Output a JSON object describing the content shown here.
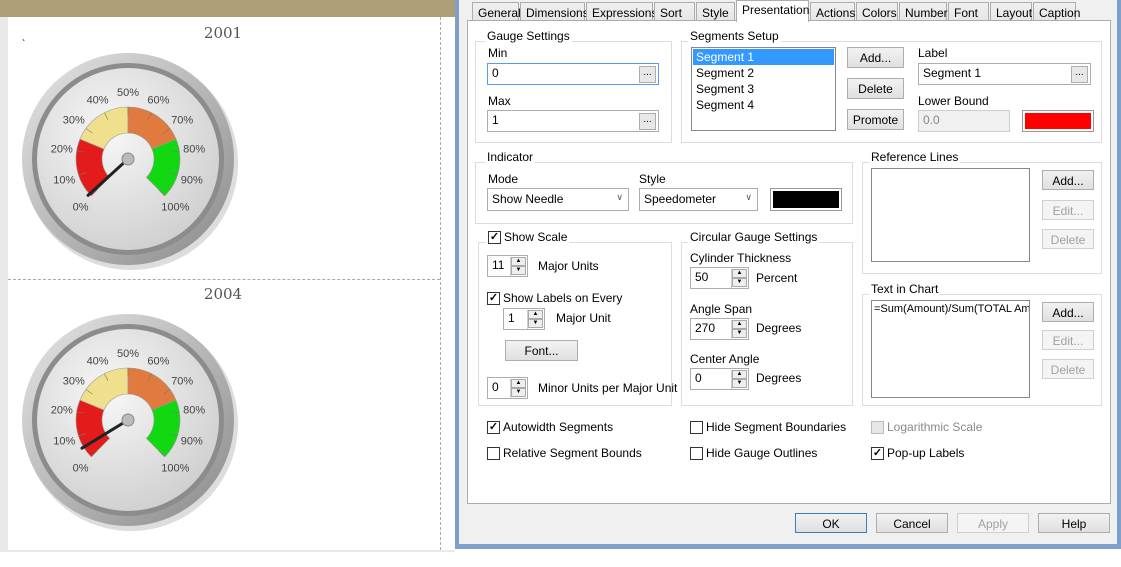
{
  "left_panel": {
    "mark": "ˎ",
    "charts": [
      {
        "title": "2001"
      },
      {
        "title": "2004"
      }
    ]
  },
  "chart_data": [
    {
      "type": "gauge",
      "title": "2001",
      "min": 0,
      "max": 1,
      "angle_span": 270,
      "tick_labels": [
        "0%",
        "10%",
        "20%",
        "30%",
        "40%",
        "50%",
        "60%",
        "70%",
        "80%",
        "90%",
        "100%"
      ],
      "segments": [
        {
          "from": 0,
          "to": 0.25,
          "color": "#e31b1b"
        },
        {
          "from": 0.25,
          "to": 0.5,
          "color": "#f0df8c"
        },
        {
          "from": 0.5,
          "to": 0.75,
          "color": "#e07a3f"
        },
        {
          "from": 0.75,
          "to": 1,
          "color": "#12d812"
        }
      ],
      "value": 0.01
    },
    {
      "type": "gauge",
      "title": "2004",
      "min": 0,
      "max": 1,
      "angle_span": 270,
      "tick_labels": [
        "0%",
        "10%",
        "20%",
        "30%",
        "40%",
        "50%",
        "60%",
        "70%",
        "80%",
        "90%",
        "100%"
      ],
      "segments": [
        {
          "from": 0,
          "to": 0.25,
          "color": "#e31b1b"
        },
        {
          "from": 0.25,
          "to": 0.5,
          "color": "#f0df8c"
        },
        {
          "from": 0.5,
          "to": 0.75,
          "color": "#e07a3f"
        },
        {
          "from": 0.75,
          "to": 1,
          "color": "#12d812"
        }
      ],
      "value": 0.05
    }
  ],
  "tabs": [
    "General",
    "Dimensions",
    "Expressions",
    "Sort",
    "Style",
    "Presentation",
    "Actions",
    "Colors",
    "Number",
    "Font",
    "Layout",
    "Caption"
  ],
  "active_tab": "Presentation",
  "gauge_settings": {
    "title": "Gauge Settings",
    "min_label": "Min",
    "min_value": "0",
    "max_label": "Max",
    "max_value": "1",
    "dots": "..."
  },
  "segments_setup": {
    "title": "Segments Setup",
    "items": [
      "Segment 1",
      "Segment 2",
      "Segment 3",
      "Segment 4"
    ],
    "selected": "Segment 1",
    "add": "Add...",
    "delete": "Delete",
    "promote": "Promote",
    "label_label": "Label",
    "label_value": "Segment 1",
    "lower_bound_label": "Lower Bound",
    "lower_bound_value": "0.0",
    "color": "#ff0000"
  },
  "indicator": {
    "title": "Indicator",
    "mode_label": "Mode",
    "mode_value": "Show Needle",
    "style_label": "Style",
    "style_value": "Speedometer",
    "color": "#000000"
  },
  "reference_lines": {
    "title": "Reference Lines",
    "add": "Add...",
    "edit": "Edit...",
    "delete": "Delete"
  },
  "scale": {
    "show_scale": "Show Scale",
    "show_scale_checked": true,
    "major_units_value": "11",
    "major_units_label": "Major Units",
    "show_labels": "Show Labels on Every",
    "show_labels_checked": true,
    "major_unit_value": "1",
    "major_unit_label": "Major Unit",
    "font_button": "Font...",
    "minor_value": "0",
    "minor_label": "Minor Units per Major Unit"
  },
  "circular": {
    "title": "Circular Gauge Settings",
    "cyl_label": "Cylinder Thickness",
    "cyl_value": "50",
    "cyl_unit": "Percent",
    "span_label": "Angle Span",
    "span_value": "270",
    "span_unit": "Degrees",
    "center_label": "Center Angle",
    "center_value": "0",
    "center_unit": "Degrees"
  },
  "text_in_chart": {
    "title": "Text in Chart",
    "value": "=Sum(Amount)/Sum(TOTAL Amount)",
    "add": "Add...",
    "edit": "Edit...",
    "delete": "Delete"
  },
  "options": {
    "autowidth": "Autowidth Segments",
    "relative": "Relative Segment Bounds",
    "hide_boundaries": "Hide Segment Boundaries",
    "hide_outlines": "Hide Gauge Outlines",
    "log": "Logarithmic Scale",
    "popup": "Pop-up Labels"
  },
  "footer": {
    "ok": "OK",
    "cancel": "Cancel",
    "apply": "Apply",
    "help": "Help"
  }
}
